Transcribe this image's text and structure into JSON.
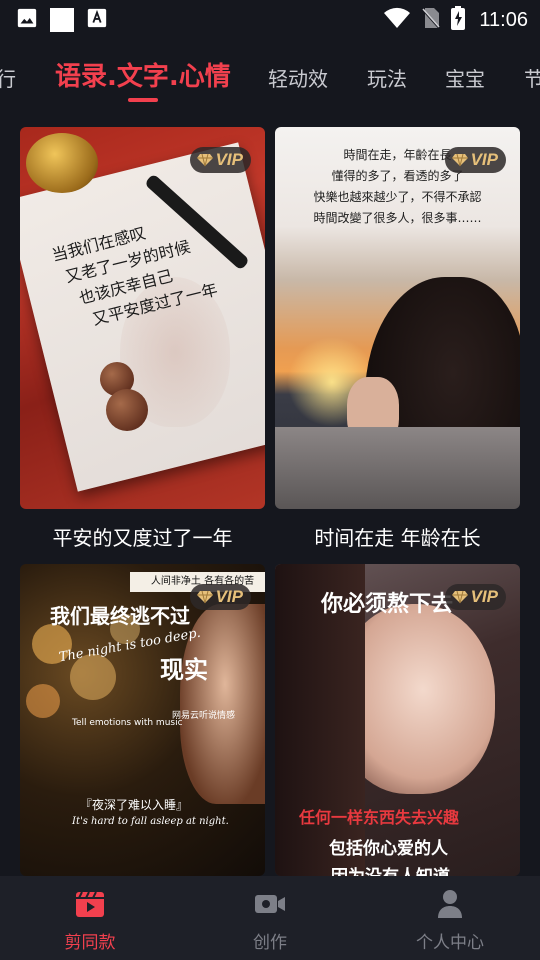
{
  "status_bar": {
    "time": "11:06",
    "icons": [
      "image-icon",
      "blank-notification-icon",
      "font-download-icon",
      "wifi-icon",
      "no-sim-icon",
      "battery-charging-icon"
    ]
  },
  "tabs": [
    {
      "label": "行",
      "active": false
    },
    {
      "label": "语录.文字.心情",
      "active": true
    },
    {
      "label": "轻动效",
      "active": false
    },
    {
      "label": "玩法",
      "active": false
    },
    {
      "label": "宝宝",
      "active": false
    },
    {
      "label": "节",
      "active": false
    }
  ],
  "badge_label": "VIP",
  "cards": [
    {
      "title": "平安的又度过了一年",
      "overlay_lines": [
        "当我们在感叹",
        "又老了一岁的时候",
        "也该庆幸自己",
        "又平安度过了一年"
      ]
    },
    {
      "title": "时间在走 年龄在长",
      "overlay_lines": [
        "時間在走，年齡在長",
        "懂得的多了，看透的多了",
        "快樂也越來越少了，不得不承認",
        "時間改變了很多人，很多事……"
      ]
    },
    {
      "title": "",
      "overlay_lines": [
        "人间非净土 各有各的苦",
        "我们最终逃不过",
        "The night is too deep.",
        "现实",
        "Tell emotions with music",
        "网易云听说情感",
        "『夜深了难以入睡』",
        "It's hard to fall asleep at night."
      ]
    },
    {
      "title": "",
      "overlay_lines": [
        "你必须熬下去",
        "任何一样东西失去兴趣",
        "包括你心爱的人",
        "因为没有人知道"
      ]
    }
  ],
  "bottom_nav": [
    {
      "label": "剪同款",
      "icon": "clapperboard-play-icon",
      "active": true
    },
    {
      "label": "创作",
      "icon": "video-camera-icon",
      "active": false
    },
    {
      "label": "个人中心",
      "icon": "person-icon",
      "active": false
    }
  ],
  "colors": {
    "accent": "#f2404e",
    "background": "#15171e",
    "nav_background": "#1e2028",
    "vip_gold": "#e6c07a"
  }
}
